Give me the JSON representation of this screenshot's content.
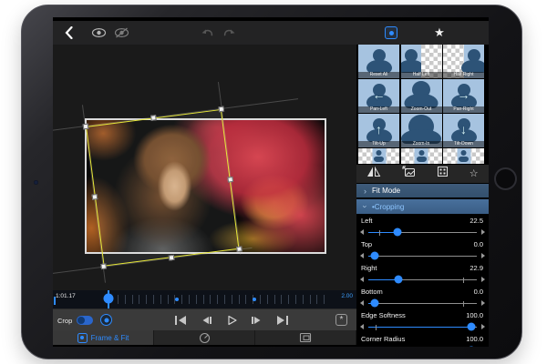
{
  "colors": {
    "accent": "#2e8bff",
    "crop_outline": "#e8e838",
    "tile_bg": "#a6c3e0",
    "silhouette": "#2d5377"
  },
  "toolbar": {
    "star": "★"
  },
  "presets": {
    "tiles": [
      {
        "label": "Reset All"
      },
      {
        "label": "Half Left"
      },
      {
        "label": "Half Right"
      },
      {
        "label": "Pan-Left",
        "arrow": "←"
      },
      {
        "label": "Zoom-Out"
      },
      {
        "label": "Pan-Right",
        "arrow": "→"
      },
      {
        "label": "Tilt-Up",
        "arrow": "↑"
      },
      {
        "label": "Zoom-In"
      },
      {
        "label": "Tilt-Down",
        "arrow": "↓"
      }
    ]
  },
  "tools": {
    "favorites_icon": "☆"
  },
  "sections": {
    "fit_mode": {
      "label": "Fit Mode",
      "chevron": "›"
    },
    "cropping": {
      "label": "•Cropping",
      "chevron": "›"
    }
  },
  "cropping_sliders": [
    {
      "label": "Left",
      "value": "22.5",
      "thumb_pct": 27,
      "fill_pct": 27,
      "tick_pct": 10
    },
    {
      "label": "Top",
      "value": "0.0",
      "thumb_pct": 6,
      "fill_pct": 6,
      "tick_pct": null
    },
    {
      "label": "Right",
      "value": "22.9",
      "thumb_pct": 28,
      "fill_pct": 28,
      "tick_pct": 87
    },
    {
      "label": "Bottom",
      "value": "0.0",
      "thumb_pct": 6,
      "fill_pct": 6,
      "tick_pct": 87
    },
    {
      "label": "Edge Softness",
      "value": "100.0",
      "thumb_pct": 95,
      "fill_pct": 95,
      "tick_pct": 7
    },
    {
      "label": "Corner Radius",
      "value": "100.0",
      "thumb_pct": 95,
      "fill_pct": 95,
      "tick_pct": null
    }
  ],
  "timeline": {
    "current_time": "1:01.17",
    "duration": "2.00",
    "playhead_pct": 18.3,
    "keyframe_pcts": [
      40.8,
      66.4
    ],
    "tick_count": 30
  },
  "transport": {
    "crop_label": "Crop",
    "toggle_on": true,
    "preset_box_char": "*"
  },
  "bottom_tabs": [
    {
      "label": "Frame & Fit",
      "active": true
    },
    {
      "name": "speed"
    },
    {
      "name": "stabilizer"
    }
  ]
}
